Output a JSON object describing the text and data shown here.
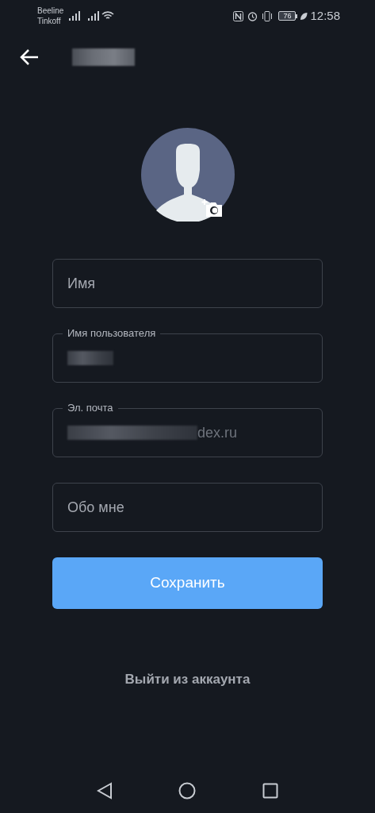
{
  "status_bar": {
    "carriers": [
      "Beeline",
      "Tinkoff"
    ],
    "battery": "76",
    "time": "12:58"
  },
  "header": {
    "title_redacted": true
  },
  "fields": [
    {
      "kind": "empty",
      "placeholder": "Имя"
    },
    {
      "kind": "filled",
      "label": "Имя пользователя",
      "redacted": true
    },
    {
      "kind": "filled",
      "label": "Эл. почта",
      "value": "dex.ru",
      "redacted": true
    },
    {
      "kind": "empty",
      "placeholder": "Обо мне"
    }
  ],
  "save_button": "Сохранить",
  "logout": "Выйти из аккаунта"
}
